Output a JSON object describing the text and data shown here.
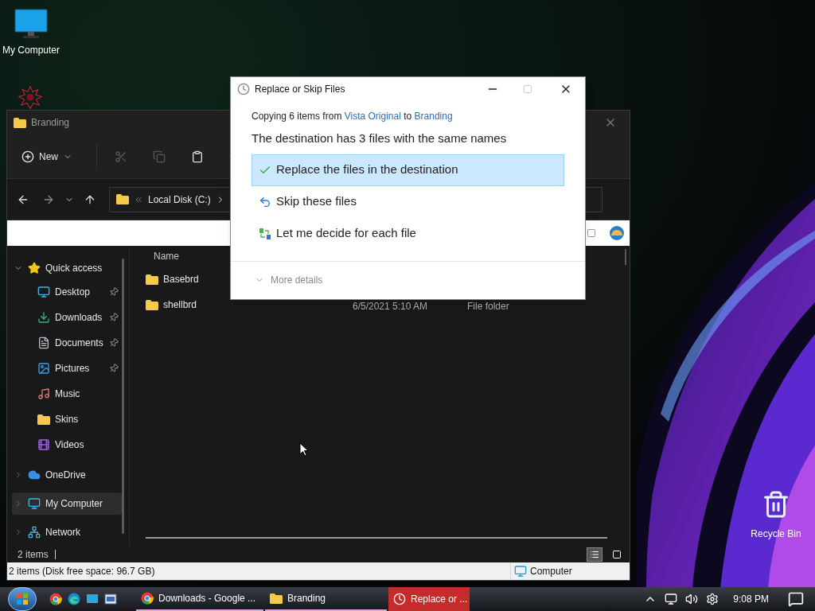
{
  "desktop_icons": [
    {
      "label": "My Computer"
    },
    {
      "label": "Recycle Bin"
    }
  ],
  "explorer": {
    "title": "Branding",
    "new_label": "New",
    "location": "Local Disk (C:)",
    "navigation": [
      {
        "label": "Quick access",
        "expanded": true,
        "selected": false,
        "children": [
          {
            "label": "Desktop",
            "pinned": true,
            "selected": false
          },
          {
            "label": "Downloads",
            "pinned": true,
            "selected": false
          },
          {
            "label": "Documents",
            "pinned": true,
            "selected": false
          },
          {
            "label": "Pictures",
            "pinned": true,
            "selected": false
          },
          {
            "label": "Music",
            "pinned": false,
            "selected": false
          },
          {
            "label": "Skins",
            "pinned": false,
            "selected": false
          },
          {
            "label": "Videos",
            "pinned": false,
            "selected": false
          }
        ]
      },
      {
        "label": "OneDrive",
        "expanded": false,
        "selected": false
      },
      {
        "label": "My Computer",
        "expanded": false,
        "selected": true
      },
      {
        "label": "Network",
        "expanded": false,
        "selected": false
      }
    ],
    "columns": [
      "Name"
    ],
    "files": [
      {
        "name": "Basebrd"
      },
      {
        "name": "shellbrd",
        "date_modified": "6/5/2021 5:10 AM",
        "type": "File folder"
      }
    ],
    "item_count": "2 items",
    "views": [
      {
        "selected": true
      },
      {
        "selected": false
      }
    ],
    "status_bar": {
      "summary": "2 items (Disk free space: 96.7 GB)",
      "location": "Computer"
    }
  },
  "dialog": {
    "title": "Replace or Skip Files",
    "copying": {
      "prefix": "Copying 6 items from",
      "source": "Vista Original",
      "joiner": "to",
      "destination": "Branding"
    },
    "heading": "The destination has 3 files with the same names",
    "options": [
      {
        "label": "Replace the files in the destination",
        "selected": true
      },
      {
        "label": "Skip these files",
        "selected": false
      },
      {
        "label": "Let me decide for each file",
        "selected": false
      }
    ],
    "more_details": "More details"
  },
  "taskbar": {
    "tasks": [
      {
        "label": "Downloads - Google ...",
        "selected": false
      },
      {
        "label": "Branding",
        "selected": false
      },
      {
        "label": "Replace or ...",
        "selected": true
      }
    ],
    "clock": "9:08 PM"
  }
}
